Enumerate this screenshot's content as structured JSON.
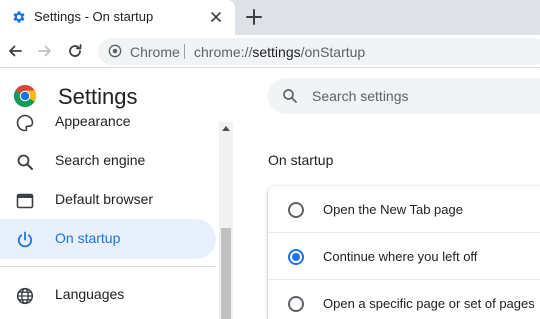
{
  "browser": {
    "tab": {
      "title": "Settings - On startup",
      "favicon": "gear-icon"
    },
    "new_tab_icon": "plus-icon",
    "toolbar": {
      "back_icon": "back-arrow-icon",
      "forward_icon": "forward-arrow-icon",
      "reload_icon": "reload-icon",
      "omnibox": {
        "chip_label": "Chrome",
        "url_prefix": "chrome://",
        "url_host": "settings",
        "url_path": "/onStartup"
      }
    }
  },
  "header": {
    "title": "Settings",
    "search": {
      "placeholder": "Search settings",
      "value": ""
    }
  },
  "sidebar": {
    "items": [
      {
        "label": "Appearance",
        "icon": "palette-icon",
        "selected": false
      },
      {
        "label": "Search engine",
        "icon": "search-icon",
        "selected": false
      },
      {
        "label": "Default browser",
        "icon": "browser-window-icon",
        "selected": false
      },
      {
        "label": "On startup",
        "icon": "power-icon",
        "selected": true
      },
      {
        "label": "Languages",
        "icon": "globe-icon",
        "selected": false
      }
    ]
  },
  "main": {
    "section_title": "On startup",
    "options": [
      {
        "label": "Open the New Tab page",
        "checked": false
      },
      {
        "label": "Continue where you left off",
        "checked": true
      },
      {
        "label": "Open a specific page or set of pages",
        "checked": false
      }
    ]
  },
  "colors": {
    "accent": "#1a73e8",
    "selected_bg": "#e8f0fe",
    "tabstrip_bg": "#dee1e6",
    "search_bg": "#f1f3f4"
  }
}
